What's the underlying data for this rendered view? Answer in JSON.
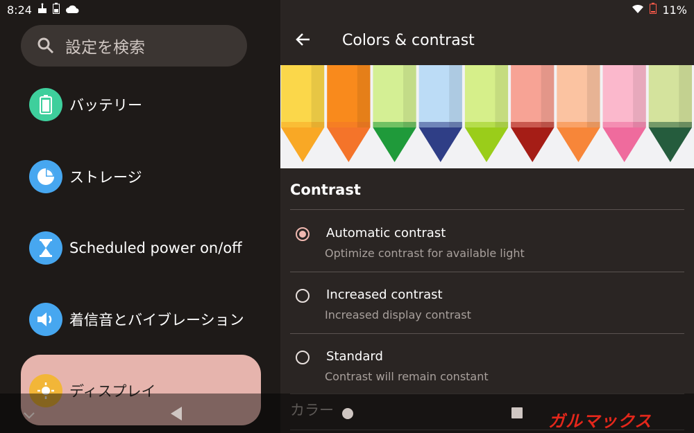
{
  "status": {
    "time": "8:24",
    "battery": "11%"
  },
  "search": {
    "placeholder": "設定を検索"
  },
  "settings": [
    {
      "label": "バッテリー",
      "icon": "battery-icon",
      "color": "#3ecf9c"
    },
    {
      "label": "ストレージ",
      "icon": "storage-pie-icon",
      "color": "#47a7f0"
    },
    {
      "label": "Scheduled power on/off",
      "icon": "hourglass-icon",
      "color": "#47a7f0"
    },
    {
      "label": "着信音とバイブレーション",
      "icon": "volume-icon",
      "color": "#47a7f0"
    },
    {
      "label": "ディスプレイ",
      "icon": "brightness-icon",
      "color": "#f2b638"
    }
  ],
  "page": {
    "title": "Colors & contrast"
  },
  "contrast": {
    "heading": "Contrast",
    "options": [
      {
        "title": "Automatic contrast",
        "subtitle": "Optimize contrast for available light",
        "selected": true
      },
      {
        "title": "Increased contrast",
        "subtitle": "Increased display contrast",
        "selected": false
      },
      {
        "title": "Standard",
        "subtitle": "Contrast will remain constant",
        "selected": false
      }
    ]
  },
  "colors": {
    "heading": "カラー"
  },
  "crayons": [
    {
      "body": "#fbd74a",
      "tip": "#f9a825"
    },
    {
      "body": "#f98a1c",
      "tip": "#f4742a"
    },
    {
      "body": "#d4ef94",
      "tip": "#1f9a3a"
    },
    {
      "body": "#bcdcf6",
      "tip": "#2f3e86"
    },
    {
      "body": "#d6ef8a",
      "tip": "#9acd1a"
    },
    {
      "body": "#f7a395",
      "tip": "#a51d16"
    },
    {
      "body": "#fbc3a1",
      "tip": "#f78639"
    },
    {
      "body": "#fbb8cc",
      "tip": "#ef6b9d"
    },
    {
      "body": "#d4e39d",
      "tip": "#255c3d"
    }
  ],
  "watermark": {
    "text": "ガルマックス",
    "color": "#e4271b"
  }
}
